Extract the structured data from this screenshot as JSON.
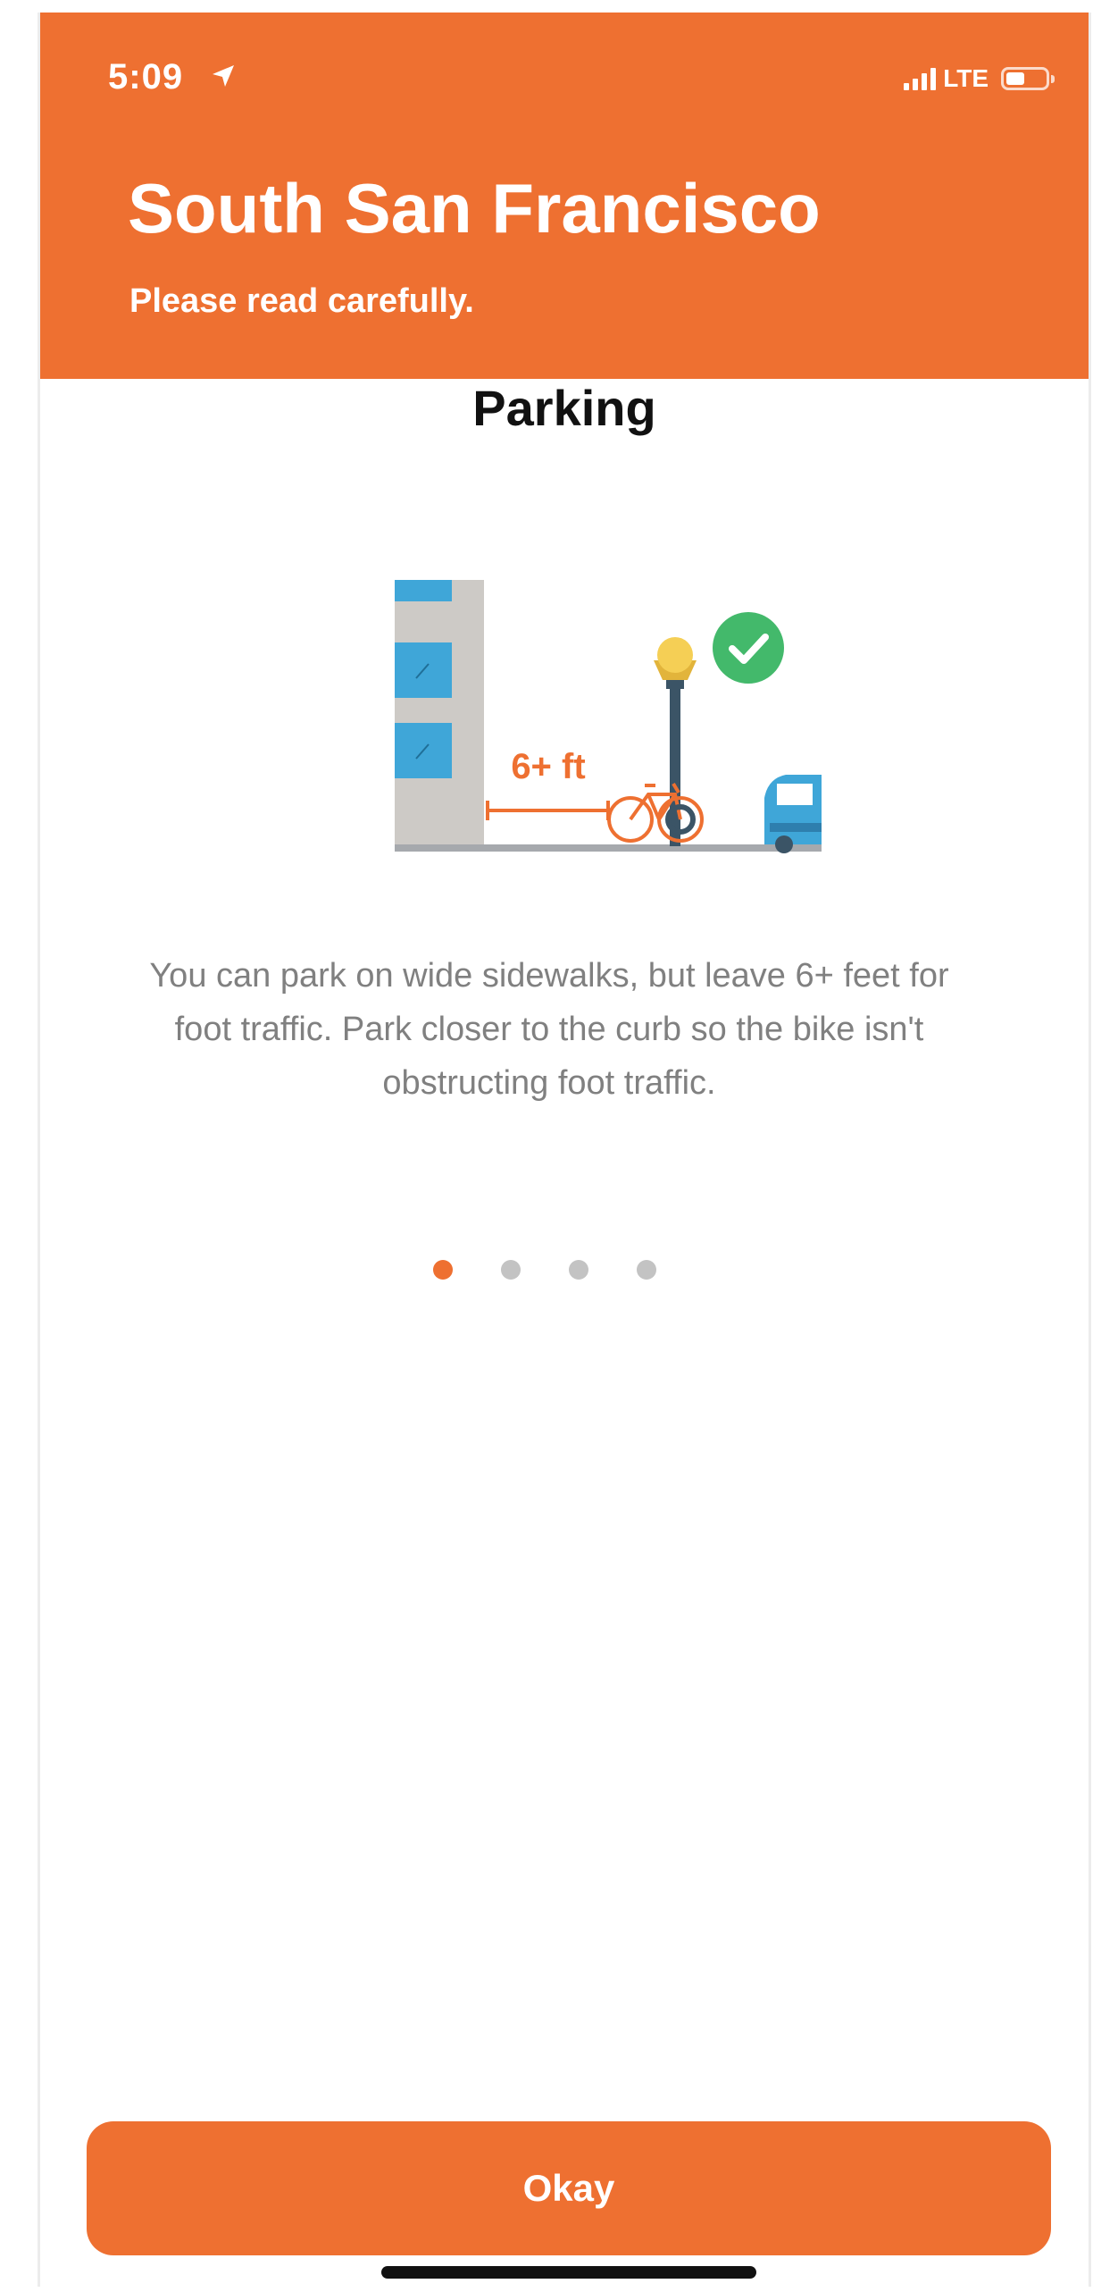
{
  "status_bar": {
    "time": "5:09",
    "network": "LTE",
    "icons": [
      "location-arrow-icon",
      "signal-icon",
      "battery-icon"
    ]
  },
  "header": {
    "title": "South San Francisco",
    "subtitle": "Please read carefully."
  },
  "slide": {
    "title": "Parking",
    "illustration_label": "6+ ft",
    "body": "You can park on wide sidewalks, but leave 6+ feet for foot traffic. Park closer to the curb so the bike isn't obstructing foot traffic."
  },
  "pagination": {
    "current": 1,
    "total": 4
  },
  "actions": {
    "okay_label": "Okay"
  },
  "colors": {
    "brand": "#ee7031",
    "body_text": "#808080",
    "inactive_dot": "#c3c3c3",
    "check_green": "#43b96b",
    "building_blue": "#3fa6d8"
  }
}
